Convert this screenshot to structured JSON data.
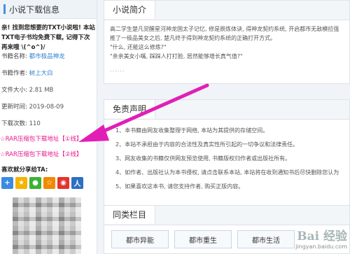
{
  "left": {
    "title": "小说下载信息",
    "intro": "亲! 找到您想要的TXT小说啦! 本站TXT电子书均免费下载, 记得下次再来哦 \\(^o^)/",
    "rows": [
      {
        "label": "书籍名称:",
        "value": "都市极品神龙",
        "link": true
      },
      {
        "label": "书籍作者:",
        "value": "树上大白",
        "link": true
      },
      {
        "label": "文件大小:",
        "value": "2.81 MB",
        "link": false
      },
      {
        "label": "更新时间:",
        "value": "2019-08-09",
        "link": false
      },
      {
        "label": "下载次数:",
        "value": "110",
        "link": false
      }
    ],
    "download_links": [
      "☆RAR压缩包下载地址【①线】",
      "☆RAR压缩包下载地址【②线】"
    ],
    "share_title": "喜欢就分享给TA:",
    "share_icons": [
      "plus-icon",
      "qzone-icon",
      "wechat-icon",
      "star-icon",
      "weibo-icon",
      "renren-icon"
    ]
  },
  "intro_panel": {
    "tab": "小说简介",
    "paragraph": "高二学生楚凡觉醒星河神龙国太子记忆, 修是辰炼体诀, 得神龙契约系统, 开启都市无敌模拉强推了一极品美女之后, 楚凡终于得到神龙契约系统的正确打开方式。",
    "quote1": "\"什么, 还能这么修炼?\"",
    "quote2": "\"亲亲美女小嘴, 踩踩人打打脸, 居然能够增长真气值?\"",
    "ellipsis": "......"
  },
  "disclaimer": {
    "tab": "免责声明",
    "items": [
      "1、本书籍由网友收集整理于网络, 本站为其提供的存储空间。",
      "2、本站不承担由于内容的合法性及真实性所引起的一切争议和法律责任。",
      "3、网友收集的书籍仅供网友预览使用, 书籍版权归作者或出版社所有。",
      "4、如作者、出版社认为本书侵权, 请点击联系本站, 本站将在收到通知书后尽快删除您认为",
      "5、如果喜欢这本书, 请您支持作者, 购买正版内容。"
    ]
  },
  "related": {
    "tab": "同类栏目",
    "tags": [
      "都市异能",
      "都市重生",
      "都市生活"
    ]
  },
  "watermark": {
    "logo": "Bai 经验",
    "url": "jingyan.baidu.com"
  },
  "colors": {
    "accent": "#4a90d9",
    "download": "#e8168a",
    "arrow": "#e11fb6"
  }
}
